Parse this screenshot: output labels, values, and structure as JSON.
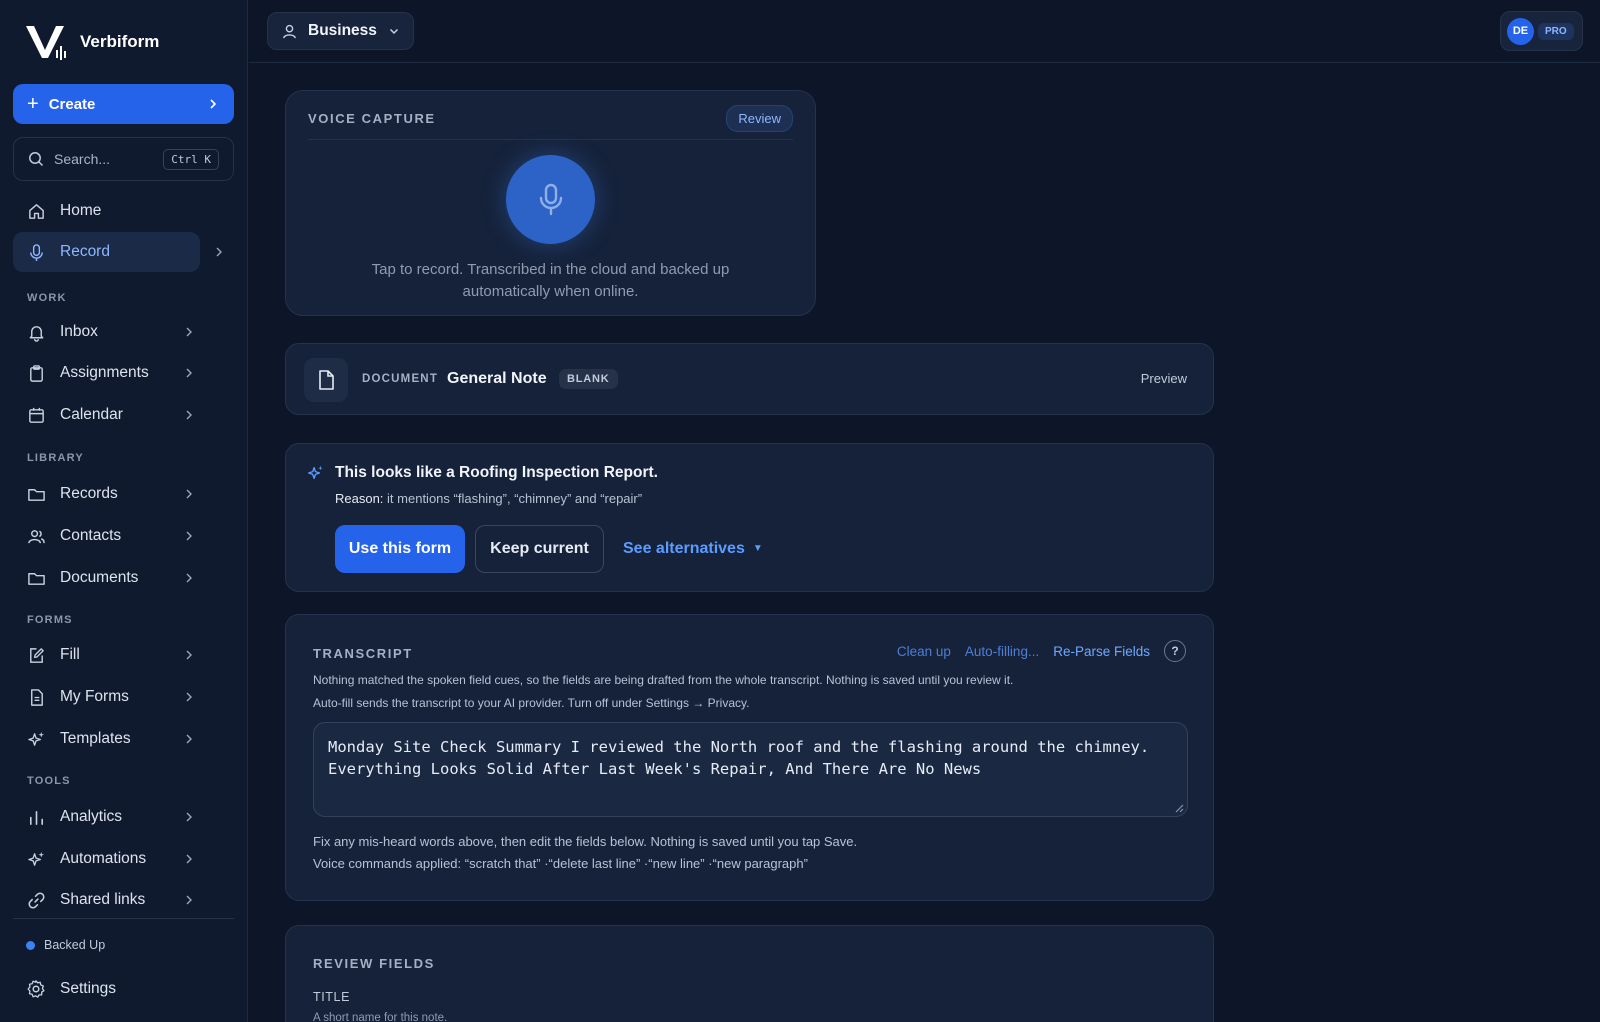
{
  "brand": {
    "name": "Verbiform"
  },
  "sidebar": {
    "create_label": "Create",
    "search_placeholder": "Search...",
    "search_shortcut": "Ctrl K",
    "home": "Home",
    "record": "Record",
    "sections": {
      "work": "WORK",
      "library": "LIBRARY",
      "forms": "FORMS",
      "tools": "TOOLS"
    },
    "work_items": [
      "Inbox",
      "Assignments",
      "Calendar"
    ],
    "library_items": [
      "Records",
      "Contacts",
      "Documents"
    ],
    "forms_items": [
      "Fill",
      "My Forms",
      "Templates"
    ],
    "tools_items": [
      "Analytics",
      "Automations",
      "Shared links"
    ],
    "status": "Backed Up",
    "settings": "Settings"
  },
  "topbar": {
    "workspace": "Business",
    "user_initials": "DE",
    "plan_badge": "PRO"
  },
  "voice_capture": {
    "title": "VOICE CAPTURE",
    "review_label": "Review",
    "hint": "Tap to record. Transcribed in the cloud and backed up automatically when online."
  },
  "document": {
    "label": "DOCUMENT",
    "name": "General Note",
    "badge": "BLANK",
    "preview_label": "Preview"
  },
  "suggestion": {
    "title": "This looks like a Roofing Inspection Report.",
    "reason_label": "Reason:",
    "reason_text": "it mentions “flashing”, “chimney” and “repair”",
    "use_form": "Use this form",
    "keep_current": "Keep current",
    "see_alternatives": "See alternatives"
  },
  "transcript": {
    "title": "TRANSCRIPT",
    "clean_up": "Clean up",
    "auto_filling": "Auto-filling...",
    "reparse": "Re-Parse Fields",
    "help": "?",
    "note1": "Nothing matched the spoken field cues, so the fields are being drafted from the whole transcript. Nothing is saved until you review it.",
    "note2": "Auto-fill sends the transcript to your AI provider. Turn off under Settings → Privacy.",
    "text_line1": "Monday Site Check Summary I reviewed the North roof and the flashing around the chimney.",
    "text_line2": "Everything Looks Solid After Last Week's Repair, And There Are No News",
    "foot1": "Fix any mis-heard words above, then edit the fields below. Nothing is saved until you tap Save.",
    "foot2": "Voice commands applied: “scratch that” ·“delete last line” ·“new line” ·“new paragraph”"
  },
  "review_fields": {
    "title": "REVIEW FIELDS",
    "field_title_label": "TITLE",
    "field_title_hint": "A short name for this note."
  },
  "colors": {
    "background": "#0d1628",
    "sidebar": "#0f1a2e",
    "card": "#16223a",
    "accent": "#2563eb",
    "link": "#5b9cff"
  }
}
